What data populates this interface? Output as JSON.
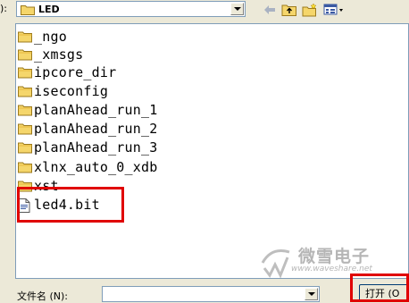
{
  "dialog": {
    "lookin": {
      "label": "):",
      "value": "LED"
    },
    "files": [
      {
        "name": "_ngo",
        "type": "folder"
      },
      {
        "name": "_xmsgs",
        "type": "folder"
      },
      {
        "name": "ipcore_dir",
        "type": "folder"
      },
      {
        "name": "iseconfig",
        "type": "folder"
      },
      {
        "name": "planAhead_run_1",
        "type": "folder"
      },
      {
        "name": "planAhead_run_2",
        "type": "folder"
      },
      {
        "name": "planAhead_run_3",
        "type": "folder"
      },
      {
        "name": "xlnx_auto_0_xdb",
        "type": "folder"
      },
      {
        "name": "xst",
        "type": "folder"
      },
      {
        "name": "led4.bit",
        "type": "file"
      }
    ],
    "filename": {
      "label": "文件名 (N):",
      "value": ""
    },
    "open_button": "打开 (O"
  },
  "watermark": {
    "text": "微雪电子",
    "url": "www.waveshare.net"
  },
  "colors": {
    "folder_yellow": "#f5d66b",
    "highlight_red": "#e00000"
  },
  "icons": {
    "back": "back-arrow-icon",
    "up": "up-folder-icon",
    "new_folder": "new-folder-icon",
    "view_menu": "view-menu-icon"
  }
}
